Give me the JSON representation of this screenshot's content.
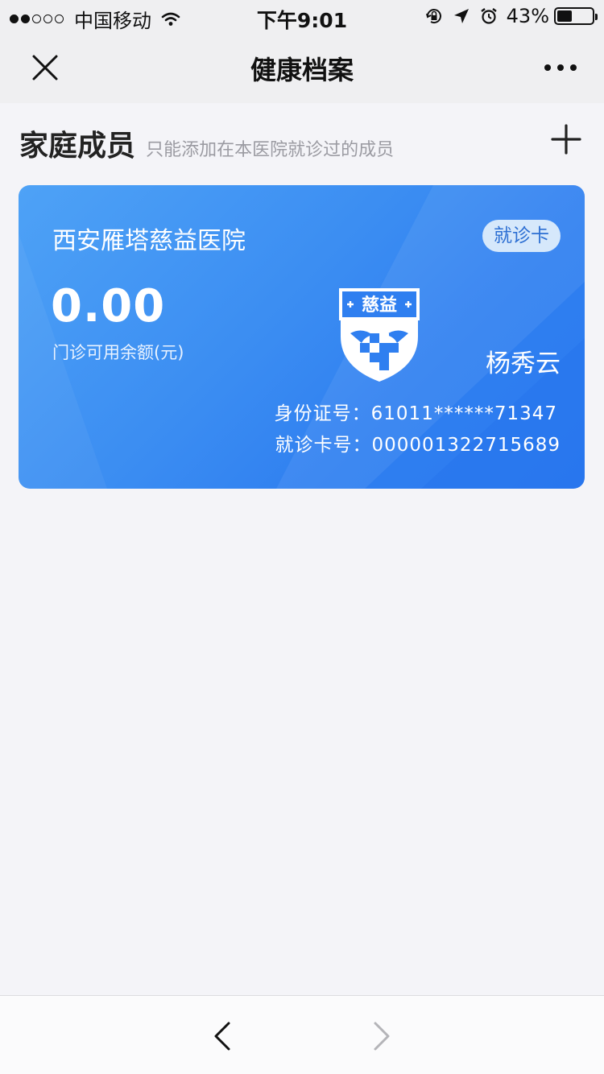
{
  "status_bar": {
    "carrier": "中国移动",
    "time": "下午9:01",
    "battery_percent": "43%",
    "battery_level": 0.43,
    "signal_bars": 2
  },
  "nav": {
    "title": "健康档案",
    "close_icon": "close-icon",
    "more_icon": "more-icon"
  },
  "family": {
    "title": "家庭成员",
    "subtitle": "只能添加在本医院就诊过的成员",
    "add_icon": "plus-icon"
  },
  "card": {
    "hospital_name": "西安雁塔慈益医院",
    "badge": "就诊卡",
    "balance": "0.00",
    "balance_label": "门诊可用余额(元)",
    "logo_text": "慈益",
    "holder_name": "杨秀云",
    "id_label": "身份证号：",
    "id_value": "61011******71347",
    "card_no_label": "就诊卡号：",
    "card_no_value": "000001322715689",
    "colors": {
      "primary": "#3b8df2",
      "badge_bg": "#d6e8fb",
      "badge_text": "#2d6fd3"
    }
  },
  "toolbar": {
    "back_icon": "chevron-left-icon",
    "forward_icon": "chevron-right-icon"
  }
}
